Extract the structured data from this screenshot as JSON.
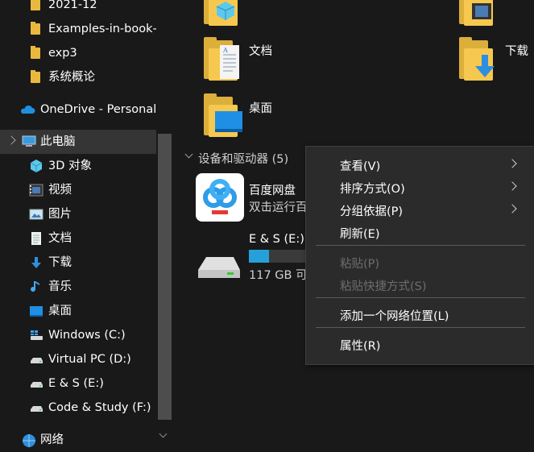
{
  "nav": {
    "items": [
      {
        "label": "2021-12",
        "icon": "folder-icon"
      },
      {
        "label": "Examples-in-book-",
        "icon": "folder-icon"
      },
      {
        "label": "exp3",
        "icon": "folder-icon"
      },
      {
        "label": "系统概论",
        "icon": "folder-icon"
      },
      {
        "label": "OneDrive - Personal",
        "icon": "onedrive-icon"
      },
      {
        "label": "此电脑",
        "icon": "this-pc-icon"
      },
      {
        "label": "3D 对象",
        "icon": "3d-objects-icon"
      },
      {
        "label": "视频",
        "icon": "videos-icon"
      },
      {
        "label": "图片",
        "icon": "pictures-icon"
      },
      {
        "label": "文档",
        "icon": "documents-icon"
      },
      {
        "label": "下载",
        "icon": "downloads-icon"
      },
      {
        "label": "音乐",
        "icon": "music-icon"
      },
      {
        "label": "桌面",
        "icon": "desktop-icon"
      },
      {
        "label": "Windows (C:)",
        "icon": "windows-drive-icon"
      },
      {
        "label": "Virtual PC (D:)",
        "icon": "drive-icon"
      },
      {
        "label": "E & S (E:)",
        "icon": "drive-icon"
      },
      {
        "label": "Code & Study (F:)",
        "icon": "drive-icon"
      },
      {
        "label": "网络",
        "icon": "network-icon"
      }
    ]
  },
  "content": {
    "folders": [
      {
        "label": "文档"
      },
      {
        "label": "下载"
      },
      {
        "label": "桌面"
      }
    ],
    "section_header": "设备和驱动器 (5)",
    "baidu": {
      "name": "百度网盘",
      "subtitle": "双击运行百"
    },
    "drive_e": {
      "name": "E & S (E:)",
      "free": "117 GB 可",
      "usage_fraction": 0.35
    },
    "colors": {
      "usage_bar": "#26a0da",
      "folder": "#f6c84f"
    }
  },
  "context_menu": {
    "items": [
      {
        "label": "查看(V)",
        "submenu": true,
        "enabled": true
      },
      {
        "label": "排序方式(O)",
        "submenu": true,
        "enabled": true
      },
      {
        "label": "分组依据(P)",
        "submenu": true,
        "enabled": true
      },
      {
        "label": "刷新(E)",
        "submenu": false,
        "enabled": true
      },
      {
        "label": "粘贴(P)",
        "submenu": false,
        "enabled": false
      },
      {
        "label": "粘贴快捷方式(S)",
        "submenu": false,
        "enabled": false
      },
      {
        "label": "添加一个网络位置(L)",
        "submenu": false,
        "enabled": true
      },
      {
        "label": "属性(R)",
        "submenu": false,
        "enabled": true
      }
    ]
  }
}
